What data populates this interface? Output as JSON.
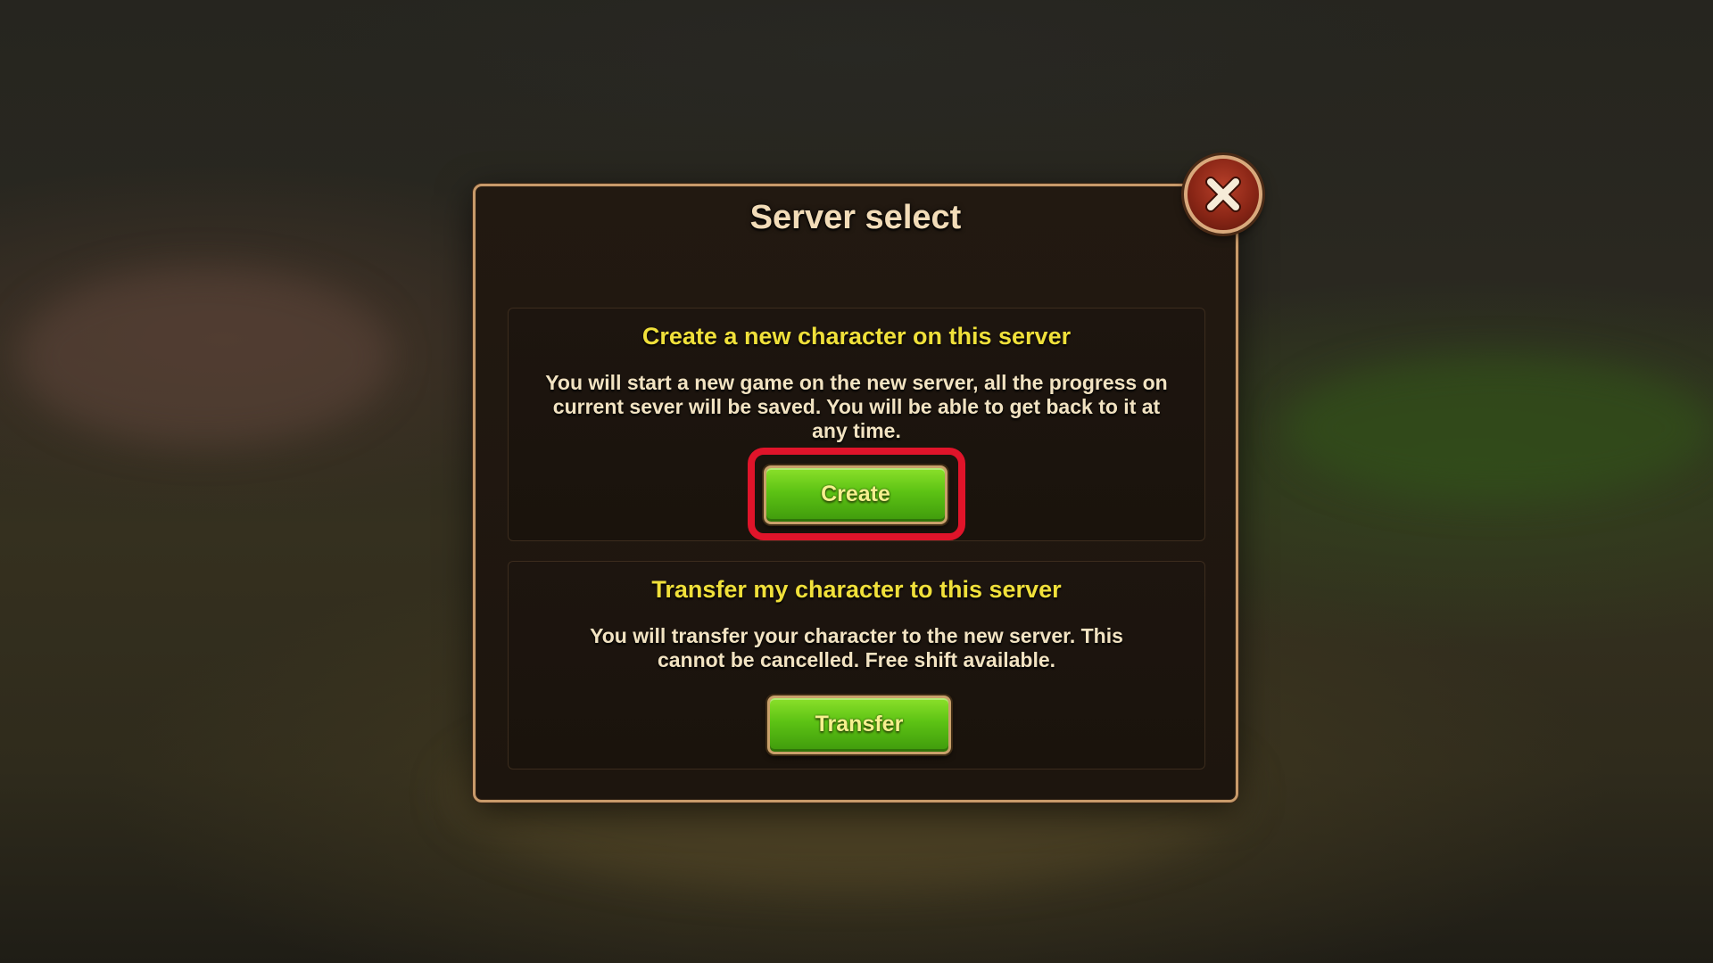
{
  "dialog": {
    "title": "Server select",
    "close_icon": "close-x-icon"
  },
  "create_section": {
    "title": "Create a new character on this server",
    "description": "You will start a new game on the new server, all the progress on current sever will be saved. You will be able to get back to it at any time.",
    "button_label": "Create"
  },
  "transfer_section": {
    "title": "Transfer my character to this server",
    "description": "You will transfer your character to the new server. This cannot be cancelled. Free shift available.",
    "button_label": "Transfer"
  },
  "colors": {
    "section_title": "#f0e03a",
    "button_green": "#5cc214",
    "highlight_red": "#e0142a",
    "dialog_border": "#c89a6a"
  }
}
